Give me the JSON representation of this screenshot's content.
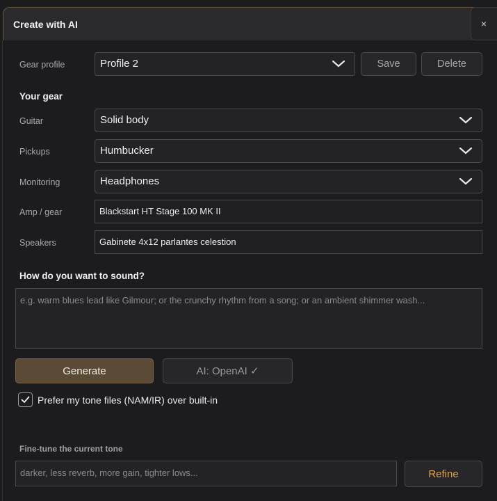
{
  "dialog": {
    "title": "Create with AI",
    "close_glyph": "×"
  },
  "gear_profile": {
    "label": "Gear profile",
    "selected": "Profile 2",
    "save_label": "Save",
    "delete_label": "Delete"
  },
  "your_gear": {
    "heading": "Your gear",
    "guitar": {
      "label": "Guitar",
      "selected": "Solid body"
    },
    "pickups": {
      "label": "Pickups",
      "selected": "Humbucker"
    },
    "monitoring": {
      "label": "Monitoring",
      "selected": "Headphones"
    },
    "amp": {
      "label": "Amp / gear",
      "value": "Blackstart HT Stage 100 MK II"
    },
    "speakers": {
      "label": "Speakers",
      "value": "Gabinete 4x12 parlantes celestion"
    }
  },
  "sound": {
    "heading": "How do you want to sound?",
    "placeholder": "e.g. warm blues lead like Gilmour; or the crunchy rhythm from a song; or an ambient shimmer wash..."
  },
  "actions": {
    "generate_label": "Generate",
    "ai_provider_label": "AI: OpenAI ✓"
  },
  "prefer_tone_files": {
    "checked": true,
    "label": "Prefer my tone files (NAM/IR) over built-in"
  },
  "fine_tune": {
    "heading": "Fine-tune the current tone",
    "placeholder": "darker, less reverb, more gain, tighter lows...",
    "refine_label": "Refine"
  },
  "colors": {
    "background": "#1c1c1f",
    "accent_button": "#5a4a36",
    "refine_text": "#e0a44e"
  },
  "icons": {
    "dropdown": "chevron-down-icon",
    "checkbox": "checkmark-icon",
    "close": "close-icon"
  }
}
